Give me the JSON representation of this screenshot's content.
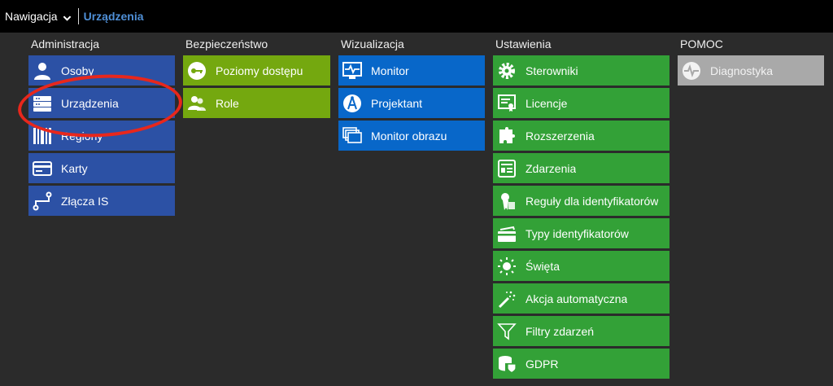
{
  "topbar": {
    "nav_label": "Nawigacja",
    "breadcrumb": "Urządzenia"
  },
  "colors": {
    "administracja": "#2c51a5",
    "bezpieczenstwo": "#74a80f",
    "wizualizacja": "#0867c9",
    "ustawienia": "#33a137",
    "pomoc": "#a9a9a9",
    "annotation": "#e8271c"
  },
  "columns": {
    "administracja": {
      "title": "Administracja",
      "items": [
        {
          "label": "Osoby",
          "icon": "person-icon"
        },
        {
          "label": "Urządzenia",
          "icon": "server-icon"
        },
        {
          "label": "Regiony",
          "icon": "barcode-region-icon"
        },
        {
          "label": "Karty",
          "icon": "card-icon"
        },
        {
          "label": "Złącza IS",
          "icon": "connector-icon"
        }
      ]
    },
    "bezpieczenstwo": {
      "title": "Bezpieczeństwo",
      "items": [
        {
          "label": "Poziomy dostępu",
          "icon": "key-icon"
        },
        {
          "label": "Role",
          "icon": "users-icon"
        }
      ]
    },
    "wizualizacja": {
      "title": "Wizualizacja",
      "items": [
        {
          "label": "Monitor",
          "icon": "monitor-pulse-icon"
        },
        {
          "label": "Projektant",
          "icon": "compass-icon"
        },
        {
          "label": "Monitor obrazu",
          "icon": "screens-icon"
        }
      ]
    },
    "ustawienia": {
      "title": "Ustawienia",
      "items": [
        {
          "label": "Sterowniki",
          "icon": "gear-icon"
        },
        {
          "label": "Licencje",
          "icon": "certificate-icon"
        },
        {
          "label": "Rozszerzenia",
          "icon": "puzzle-icon"
        },
        {
          "label": "Zdarzenia",
          "icon": "event-icon"
        },
        {
          "label": "Reguły dla identyfikatorów",
          "icon": "tag-rule-icon"
        },
        {
          "label": "Typy identyfikatorów",
          "icon": "card-types-icon"
        },
        {
          "label": "Święta",
          "icon": "sun-icon"
        },
        {
          "label": "Akcja automatyczna",
          "icon": "magic-wand-icon"
        },
        {
          "label": "Filtry zdarzeń",
          "icon": "filter-icon"
        },
        {
          "label": "GDPR",
          "icon": "database-shield-icon"
        }
      ]
    },
    "pomoc": {
      "title": "POMOC",
      "items": [
        {
          "label": "Diagnostyka",
          "icon": "pulse-circle-icon"
        }
      ]
    }
  }
}
